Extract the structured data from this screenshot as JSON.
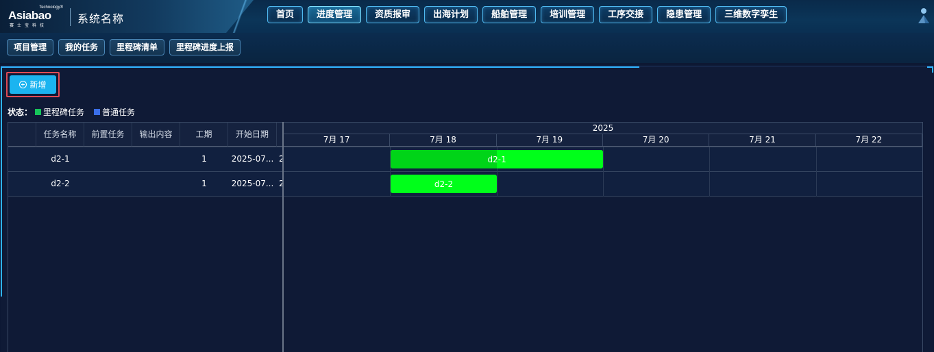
{
  "header": {
    "logo": {
      "main": "Asiabao",
      "tech": "Technology®",
      "sub": "赛士宝科技"
    },
    "system_name": "系统名称",
    "nav": [
      {
        "label": "首页",
        "active": false
      },
      {
        "label": "进度管理",
        "active": true
      },
      {
        "label": "资质报审",
        "active": false
      },
      {
        "label": "出海计划",
        "active": false
      },
      {
        "label": "船舶管理",
        "active": false
      },
      {
        "label": "培训管理",
        "active": false
      },
      {
        "label": "工序交接",
        "active": false
      },
      {
        "label": "隐患管理",
        "active": false
      },
      {
        "label": "三维数字孪生",
        "active": false
      }
    ],
    "user_icon": "user-avatar-icon"
  },
  "subnav": [
    "项目管理",
    "我的任务",
    "里程碑清单",
    "里程碑进度上报"
  ],
  "toolbar": {
    "add_label": "新增",
    "add_icon": "plus-circle-icon"
  },
  "legend": {
    "label": "状态：",
    "items": [
      {
        "label": "里程碑任务",
        "color": "#16c55a"
      },
      {
        "label": "普通任务",
        "color": "#3a6ee8"
      }
    ]
  },
  "grid": {
    "columns": [
      "任务名称",
      "前置任务",
      "输出内容",
      "工期",
      "开始日期"
    ],
    "rows": [
      {
        "name": "d2-1",
        "predecessor": "",
        "output": "",
        "duration": "1",
        "start": "2025-07...",
        "extra": "2"
      },
      {
        "name": "d2-2",
        "predecessor": "",
        "output": "",
        "duration": "1",
        "start": "2025-07...",
        "extra": "2"
      }
    ]
  },
  "timeline": {
    "year": "2025",
    "days": [
      "7月 17",
      "7月 18",
      "7月 19",
      "7月 20",
      "7月 21",
      "7月 22"
    ],
    "tasks": [
      {
        "label": "d2-1",
        "start_day": 1,
        "span_days": 2,
        "progress": 0.5
      },
      {
        "label": "d2-2",
        "start_day": 1,
        "span_days": 1,
        "progress": 0
      }
    ],
    "colors": {
      "bar": "#00ff1a",
      "progress": "#00d418"
    }
  }
}
